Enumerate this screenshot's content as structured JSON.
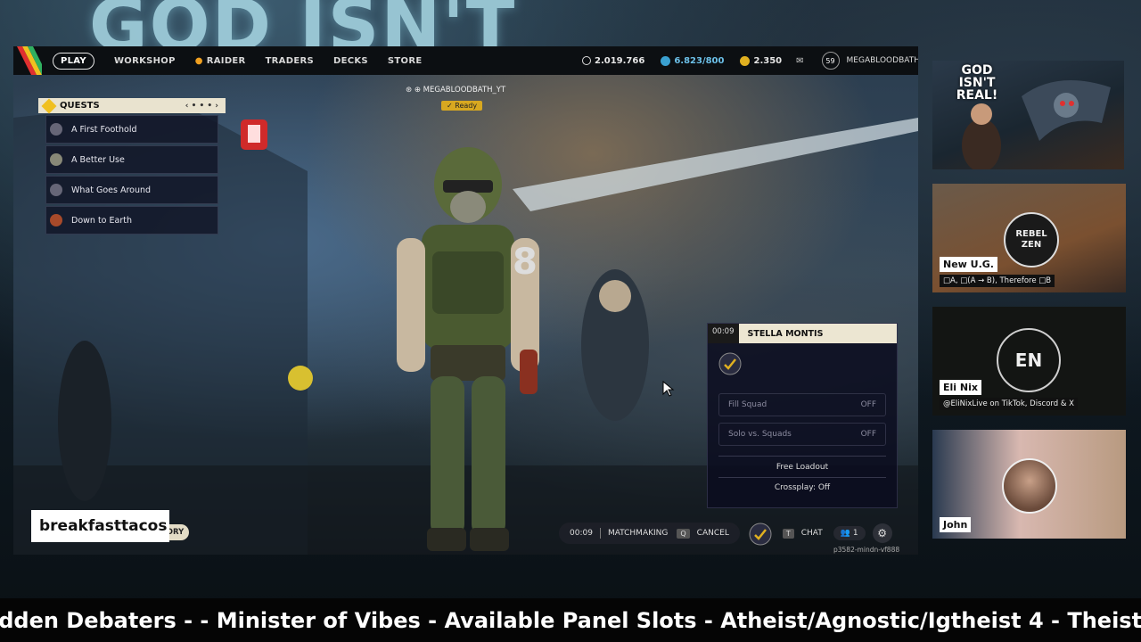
{
  "banner": {
    "text": "GOD ISN'T"
  },
  "game": {
    "nav": {
      "play": "PLAY",
      "workshop": "WORKSHOP",
      "raider": "RAIDER",
      "traders": "TRADERS",
      "decks": "DECKS",
      "store": "STORE"
    },
    "currency": {
      "coins": "2.019.766",
      "tokens": "6.823/800",
      "credits": "2.350"
    },
    "level": "59",
    "username": "MEGABLOODBATH_YT",
    "quests": {
      "title": "QUESTS",
      "pager": "‹ • • • ›",
      "items": [
        {
          "label": "A First Foothold"
        },
        {
          "label": "A Better Use"
        },
        {
          "label": "What Goes Around"
        },
        {
          "label": "Down to Earth"
        }
      ]
    },
    "player_header": {
      "name": "MEGABLOODBATH_YT",
      "status": "✓ Ready"
    },
    "matchmaking_panel": {
      "timer": "00:09",
      "map": "STELLA MONTIS",
      "fill_squad": {
        "label": "Fill Squad",
        "value": "OFF"
      },
      "solo_vs_squads": {
        "label": "Solo vs. Squads",
        "value": "OFF"
      },
      "free_loadout": "Free Loadout",
      "crossplay": "Crossplay: Off"
    },
    "bottom_bar": {
      "timer": "00:09",
      "matchmaking": "MATCHMAKING",
      "cancel_key": "Q",
      "cancel": "CANCEL",
      "chat_key": "T",
      "chat": "CHAT",
      "party_count": "1"
    },
    "story_button": "TORY",
    "version": "p3582-mindn-vf888"
  },
  "streamer_name": "breakfasttacos",
  "thumbnail": {
    "title": "GOD ISN'T REAL!"
  },
  "cams": [
    {
      "name": "New U.G.",
      "subtitle": "□A, □(A → B), Therefore □B",
      "logo": "REBEL ZEN"
    },
    {
      "name": "Eli Nix",
      "subtitle": "@EliNixLive on TikTok, Discord & X",
      "initials": "EN"
    },
    {
      "name": "John"
    }
  ],
  "ticker": "idden Debaters - - Minister of Vibes - Available Panel Slots - Atheist/Agnostic/Igtheist 4 - Theist/Deis"
}
